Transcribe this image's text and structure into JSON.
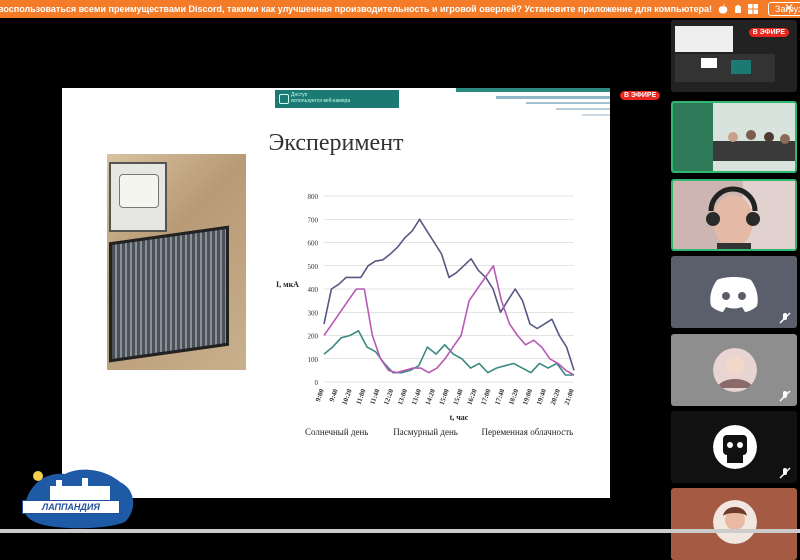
{
  "banner": {
    "text": "воспользоваться всеми преимуществами Discord, такими как улучшенная производительность и игровой оверлей? Установите приложение для компьютера!",
    "download_label": "Загрузить",
    "close_glyph": "✕",
    "icons": [
      "apple-icon",
      "android-icon",
      "windows-icon"
    ]
  },
  "stage": {
    "live_badge": "В ЭФИРЕ",
    "slide": {
      "toolbar_line1": "Доступ",
      "toolbar_line2": "используется веб-камера",
      "title": "Эксперимент",
      "legend": [
        "Солнечный день",
        "Пасмурный день",
        "Переменная облачность"
      ]
    },
    "logo_text": "ЛАППАНДИЯ"
  },
  "sidebar": {
    "tiles": [
      {
        "name": "stream-preview",
        "live_badge": "В ЭФИРЕ"
      },
      {
        "name": "conference-room"
      },
      {
        "name": "student-headphones"
      },
      {
        "name": "discord-logo-user"
      },
      {
        "name": "avatar-user-1"
      },
      {
        "name": "avatar-user-2"
      },
      {
        "name": "avatar-user-3"
      }
    ]
  },
  "chart_data": {
    "type": "line",
    "xlabel": "t, час",
    "ylabel": "I, мкА",
    "ylim": [
      0,
      800
    ],
    "yticks": [
      "0",
      "100",
      "200",
      "300",
      "400",
      "500",
      "600",
      "700",
      "800"
    ],
    "x": [
      "9:00",
      "9:40",
      "10:20",
      "11:00",
      "11:40",
      "12:20",
      "13:00",
      "13:40",
      "14:20",
      "15:00",
      "15:40",
      "16:20",
      "17:00",
      "17:40",
      "18:20",
      "19:00",
      "19:40",
      "20:20",
      "21:00"
    ],
    "series": [
      {
        "name": "Солнечный день",
        "color": "#565883",
        "values": [
          250,
          400,
          420,
          450,
          450,
          450,
          500,
          520,
          525,
          550,
          580,
          620,
          650,
          700,
          650,
          600,
          550,
          450,
          470,
          500,
          530,
          480,
          450,
          400,
          300,
          350,
          400,
          350,
          250,
          230,
          250,
          270,
          200,
          150,
          50
        ]
      },
      {
        "name": "Пасмурный день",
        "color": "#3a8a80",
        "values": [
          120,
          150,
          190,
          200,
          220,
          150,
          130,
          80,
          40,
          40,
          50,
          70,
          150,
          120,
          160,
          120,
          100,
          60,
          80,
          40,
          60,
          70,
          80,
          60,
          40,
          80,
          60,
          80,
          30,
          30
        ]
      },
      {
        "name": "Переменная облачность",
        "color": "#b65ab6",
        "values": [
          200,
          250,
          300,
          350,
          400,
          400,
          200,
          100,
          50,
          40,
          50,
          60,
          60,
          40,
          60,
          100,
          150,
          200,
          350,
          400,
          450,
          500,
          350,
          250,
          200,
          160,
          180,
          150,
          100,
          80,
          50,
          30
        ]
      }
    ]
  }
}
